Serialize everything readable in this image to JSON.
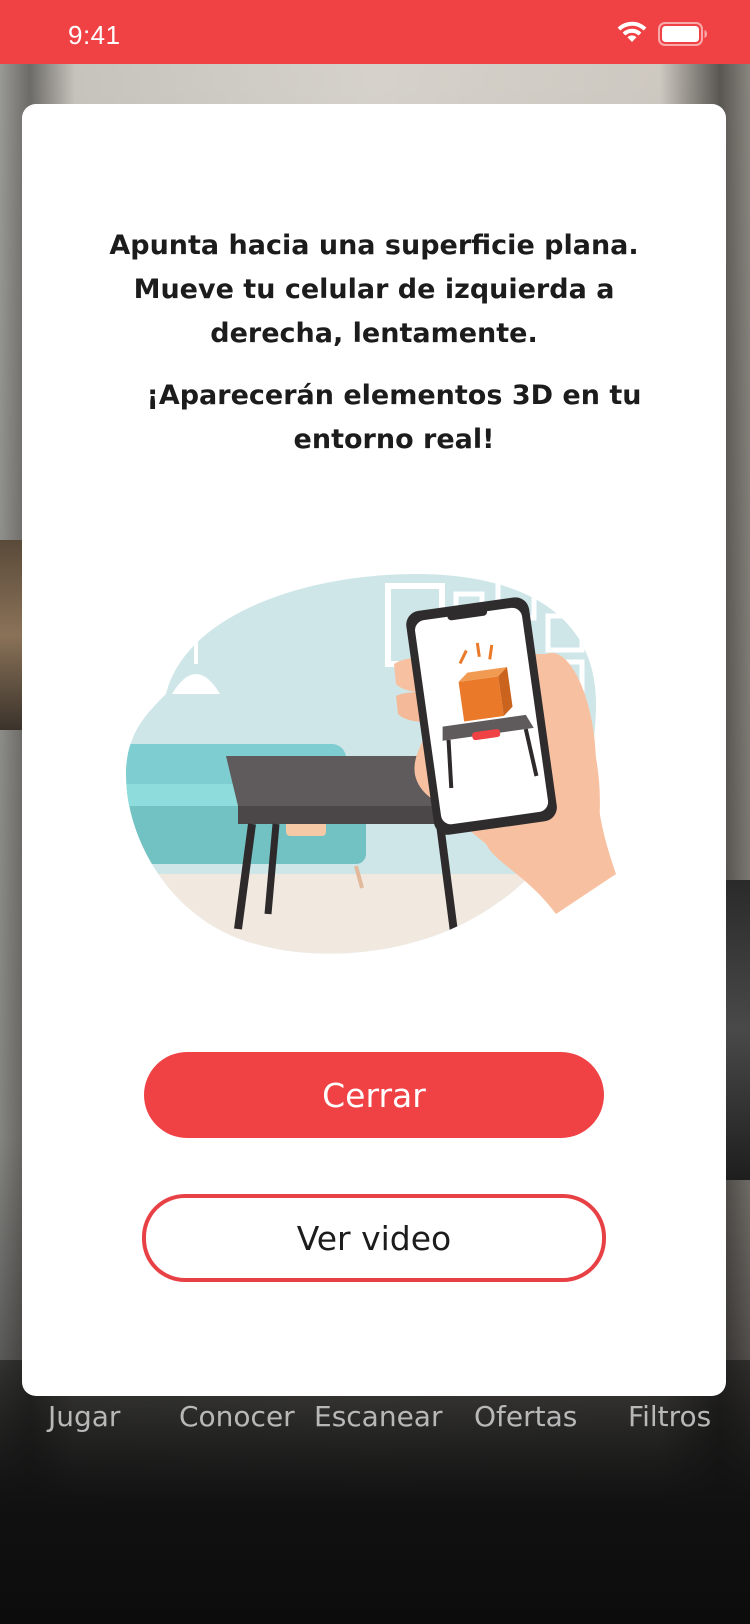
{
  "status_bar": {
    "time": "9:41",
    "wifi_icon": "wifi-icon",
    "battery_icon": "battery-icon",
    "background_color": "#f04144"
  },
  "tab_bar": {
    "items": [
      {
        "label": "Jugar"
      },
      {
        "label": "Conocer"
      },
      {
        "label": "Escanear"
      },
      {
        "label": "Ofertas"
      },
      {
        "label": "Filtros"
      }
    ]
  },
  "modal": {
    "instruction_line1": "Apunta hacia una superficie plana. Mueve tu celular de izquierda a derecha, lentamente.",
    "instruction_line2": "¡Aparecerán elementos 3D en tu entorno real!",
    "illustration": "ar-phone-table-illustration",
    "close_label": "Cerrar",
    "video_label": "Ver video",
    "accent_color": "#f04144"
  }
}
